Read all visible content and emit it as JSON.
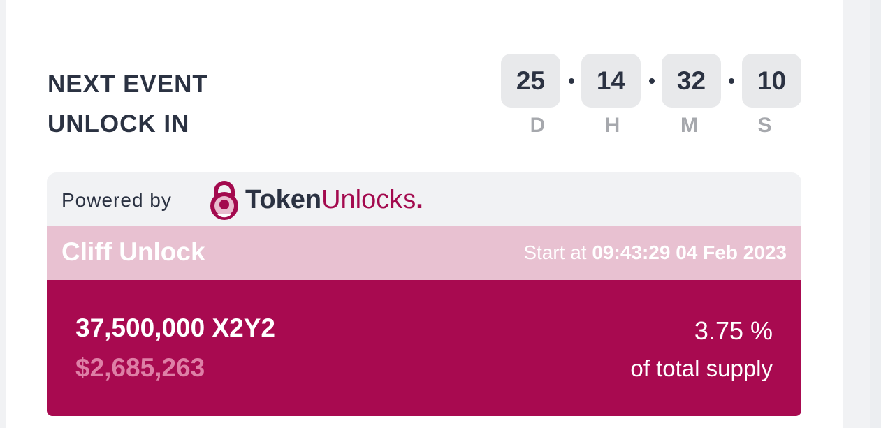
{
  "next_event": {
    "line1": "NEXT EVENT",
    "line2": "UNLOCK IN"
  },
  "countdown": {
    "days": "25",
    "hours": "14",
    "minutes": "32",
    "seconds": "10",
    "days_unit": "D",
    "hours_unit": "H",
    "minutes_unit": "M",
    "seconds_unit": "S"
  },
  "powered_by": {
    "label": "Powered by",
    "brand_part1": "Token",
    "brand_part2": "Unlocks",
    "brand_dot": ".",
    "brand_icon": "lock-icon"
  },
  "unlock": {
    "title": "Cliff Unlock",
    "start_label": "Start at",
    "start_value": "09:43:29 04 Feb 2023",
    "amount": "37,500,000 X2Y2",
    "usd_value": "$2,685,263",
    "percent": "3.75 %",
    "percent_label": "of total supply"
  },
  "colors": {
    "accent": "#a80a50",
    "header_bg": "#e8c1d1",
    "text_dark": "#2b3242",
    "muted": "#a6a8ad"
  }
}
